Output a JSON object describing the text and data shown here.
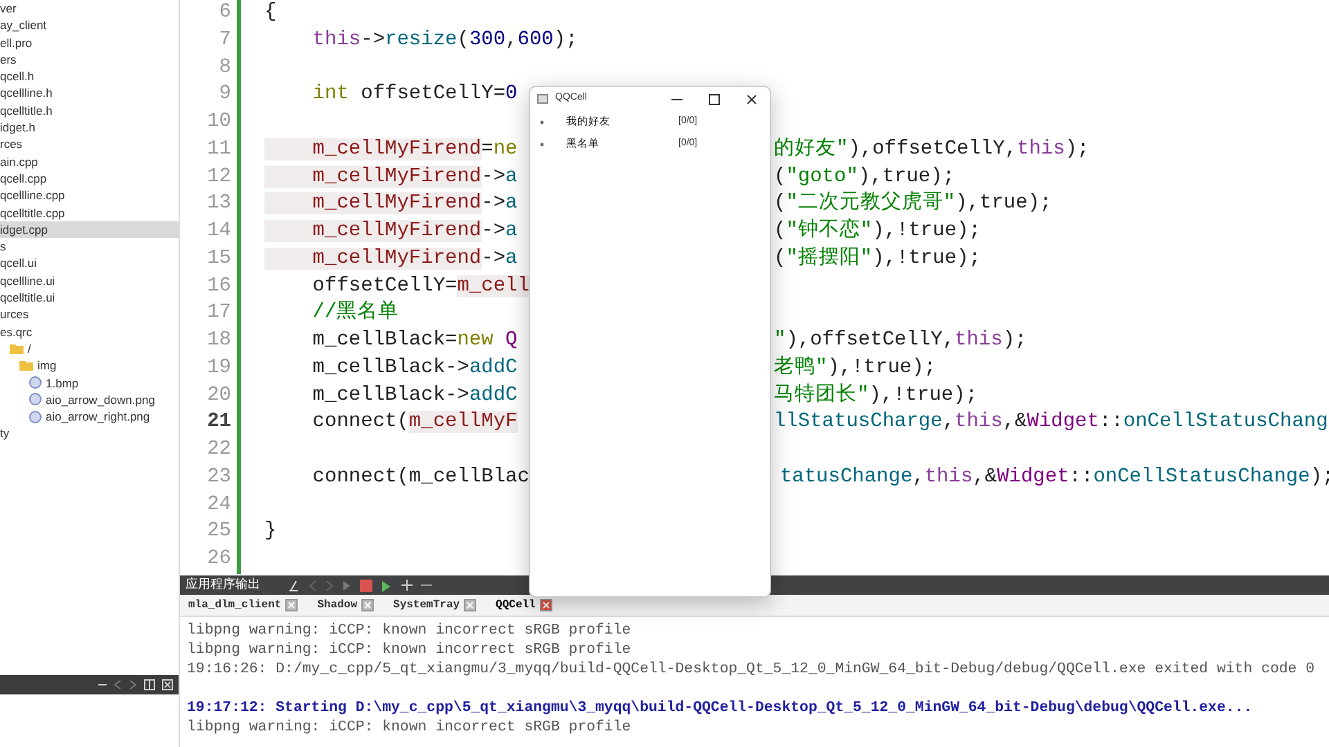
{
  "project_tree": {
    "items": [
      {
        "text": "ver",
        "selected": false
      },
      {
        "text": "ay_client",
        "selected": false
      },
      {
        "text": "ell.pro",
        "selected": false
      },
      {
        "text": "ers",
        "selected": false
      },
      {
        "text": "qcell.h",
        "selected": false
      },
      {
        "text": "qcellline.h",
        "selected": false
      },
      {
        "text": "qcelltitle.h",
        "selected": false
      },
      {
        "text": "idget.h",
        "selected": false
      },
      {
        "text": "rces",
        "selected": false
      },
      {
        "text": "ain.cpp",
        "selected": false
      },
      {
        "text": "qcell.cpp",
        "selected": false
      },
      {
        "text": "qcellline.cpp",
        "selected": false
      },
      {
        "text": "qcelltitle.cpp",
        "selected": false
      },
      {
        "text": "idget.cpp",
        "selected": true
      },
      {
        "text": "s",
        "selected": false
      },
      {
        "text": "qcell.ui",
        "selected": false
      },
      {
        "text": "qcellline.ui",
        "selected": false
      },
      {
        "text": "qcelltitle.ui",
        "selected": false
      },
      {
        "text": "urces",
        "selected": false
      },
      {
        "text": "es.qrc",
        "selected": false,
        "children": [
          {
            "text": "/",
            "selected": false,
            "kind": "folder",
            "children": [
              {
                "text": "img",
                "selected": false,
                "kind": "folder",
                "children": [
                  {
                    "text": "1.bmp",
                    "selected": false,
                    "kind": "image"
                  },
                  {
                    "text": "aio_arrow_down.png",
                    "selected": false,
                    "kind": "image"
                  },
                  {
                    "text": "aio_arrow_right.png",
                    "selected": false,
                    "kind": "image"
                  }
                ]
              }
            ]
          }
        ]
      },
      {
        "text": "ty",
        "selected": false
      }
    ]
  },
  "editor": {
    "lines": [
      {
        "number": "6",
        "current": false,
        "left": [
          {
            "text": "{",
            "kind": "plain"
          }
        ]
      },
      {
        "number": "7",
        "current": false,
        "left": [
          {
            "text": "    this",
            "kind": "self"
          },
          {
            "text": "->",
            "kind": "plain"
          },
          {
            "text": "resize",
            "kind": "method"
          },
          {
            "text": "(",
            "kind": "plain"
          },
          {
            "text": "300",
            "kind": "number"
          },
          {
            "text": ",",
            "kind": "plain"
          },
          {
            "text": "600",
            "kind": "number"
          },
          {
            "text": ");",
            "kind": "plain"
          }
        ]
      },
      {
        "number": "8",
        "current": false
      },
      {
        "number": "9",
        "current": false,
        "left": [
          {
            "text": "    int",
            "kind": "keyword"
          },
          {
            "text": " offsetCellY=",
            "kind": "plain"
          },
          {
            "text": "0",
            "kind": "number"
          }
        ]
      },
      {
        "number": "10",
        "current": false
      },
      {
        "number": "11",
        "current": false,
        "left": [
          {
            "text": "    m_cellMyFirend",
            "kind": "field"
          },
          {
            "text": "=",
            "kind": "plain"
          },
          {
            "text": "ne",
            "kind": "keyword"
          }
        ],
        "right": [
          {
            "text": "的好友\"",
            "kind": "string"
          },
          {
            "text": "),offsetCellY,",
            "kind": "plain"
          },
          {
            "text": "this",
            "kind": "self"
          },
          {
            "text": ");",
            "kind": "plain"
          }
        ]
      },
      {
        "number": "12",
        "current": false,
        "left": [
          {
            "text": "    m_cellMyFirend",
            "kind": "field"
          },
          {
            "text": "->",
            "kind": "plain"
          },
          {
            "text": "a",
            "kind": "method"
          }
        ],
        "right": [
          {
            "text": "(",
            "kind": "plain"
          },
          {
            "text": "\"goto\"",
            "kind": "string"
          },
          {
            "text": "),true);",
            "kind": "plain"
          }
        ]
      },
      {
        "number": "13",
        "current": false,
        "left": [
          {
            "text": "    m_cellMyFirend",
            "kind": "field"
          },
          {
            "text": "->",
            "kind": "plain"
          },
          {
            "text": "a",
            "kind": "method"
          }
        ],
        "right": [
          {
            "text": "(",
            "kind": "plain"
          },
          {
            "text": "\"二次元教父虎哥\"",
            "kind": "string"
          },
          {
            "text": "),true);",
            "kind": "plain"
          }
        ]
      },
      {
        "number": "14",
        "current": false,
        "left": [
          {
            "text": "    m_cellMyFirend",
            "kind": "field"
          },
          {
            "text": "->",
            "kind": "plain"
          },
          {
            "text": "a",
            "kind": "method"
          }
        ],
        "right": [
          {
            "text": "(",
            "kind": "plain"
          },
          {
            "text": "\"钟不恋\"",
            "kind": "string"
          },
          {
            "text": "),!true);",
            "kind": "plain"
          }
        ]
      },
      {
        "number": "15",
        "current": false,
        "left": [
          {
            "text": "    m_cellMyFirend",
            "kind": "field"
          },
          {
            "text": "->",
            "kind": "plain"
          },
          {
            "text": "a",
            "kind": "method"
          }
        ],
        "right": [
          {
            "text": "(",
            "kind": "plain"
          },
          {
            "text": "\"摇摆阳\"",
            "kind": "string"
          },
          {
            "text": "),!true);",
            "kind": "plain"
          }
        ]
      },
      {
        "number": "16",
        "current": false,
        "left": [
          {
            "text": "    offsetCellY=",
            "kind": "plain"
          },
          {
            "text": "m_cell",
            "kind": "field"
          }
        ]
      },
      {
        "number": "17",
        "current": false,
        "left": [
          {
            "text": "    //黑名单",
            "kind": "comment"
          }
        ]
      },
      {
        "number": "18",
        "current": false,
        "left": [
          {
            "text": "    m_cellBlack=",
            "kind": "plain"
          },
          {
            "text": "new",
            "kind": "keyword"
          },
          {
            "text": " Q",
            "kind": "type"
          }
        ],
        "right": [
          {
            "text": "\"",
            "kind": "string"
          },
          {
            "text": "),offsetCellY,",
            "kind": "plain"
          },
          {
            "text": "this",
            "kind": "self"
          },
          {
            "text": ");",
            "kind": "plain"
          }
        ]
      },
      {
        "number": "19",
        "current": false,
        "left": [
          {
            "text": "    m_cellBlack->",
            "kind": "plain"
          },
          {
            "text": "addC",
            "kind": "method"
          }
        ],
        "right": [
          {
            "text": "老鸭\"",
            "kind": "string"
          },
          {
            "text": "),!true);",
            "kind": "plain"
          }
        ]
      },
      {
        "number": "20",
        "current": false,
        "left": [
          {
            "text": "    m_cellBlack->",
            "kind": "plain"
          },
          {
            "text": "addC",
            "kind": "method"
          }
        ],
        "right": [
          {
            "text": "马特团长\"",
            "kind": "string"
          },
          {
            "text": "),!true);",
            "kind": "plain"
          }
        ]
      },
      {
        "number": "21",
        "current": true,
        "left": [
          {
            "text": "    connect(",
            "kind": "plain"
          },
          {
            "text": "m_cellMyF",
            "kind": "field"
          }
        ],
        "right": [
          {
            "text": "llStatusCharge",
            "kind": "method"
          },
          {
            "text": ",",
            "kind": "plain"
          },
          {
            "text": "this",
            "kind": "self"
          },
          {
            "text": ",&",
            "kind": "plain"
          },
          {
            "text": "Widget",
            "kind": "type"
          },
          {
            "text": "::",
            "kind": "plain"
          },
          {
            "text": "onCellStatusChang",
            "kind": "method"
          }
        ]
      },
      {
        "number": "22",
        "current": false
      },
      {
        "number": "23",
        "current": false,
        "left": [
          {
            "text": "    connect(m_cellBlac",
            "kind": "plain"
          }
        ],
        "right": [
          {
            "text": "tatusChange",
            "kind": "method"
          },
          {
            "text": ",",
            "kind": "plain"
          },
          {
            "text": "this",
            "kind": "self"
          },
          {
            "text": ",&",
            "kind": "plain"
          },
          {
            "text": "Widget",
            "kind": "type"
          },
          {
            "text": "::",
            "kind": "plain"
          },
          {
            "text": "onCellStatusChange",
            "kind": "method"
          },
          {
            "text": ");",
            "kind": "plain"
          }
        ]
      },
      {
        "number": "24",
        "current": false
      },
      {
        "number": "25",
        "current": false,
        "left": [
          {
            "text": "}",
            "kind": "plain"
          }
        ]
      },
      {
        "number": "26",
        "current": false
      }
    ]
  },
  "app_window": {
    "title": "QQCell",
    "groups": [
      {
        "name": "我的好友",
        "count": "[0/0]"
      },
      {
        "name": "黑名单",
        "count": "[0/0]"
      }
    ]
  },
  "output_pane": {
    "title": "应用程序输出",
    "tabs": [
      {
        "label": "mla_dlm_client",
        "selected": false
      },
      {
        "label": "Shadow",
        "selected": false
      },
      {
        "label": "SystemTray",
        "selected": false
      },
      {
        "label": "QQCell",
        "selected": true
      }
    ],
    "lines": [
      {
        "text": "libpng warning: iCCP: known incorrect sRGB profile",
        "kind": "warning"
      },
      {
        "text": "libpng warning: iCCP: known incorrect sRGB profile",
        "kind": "warning"
      },
      {
        "text": "19:16:26: D:/my_c_cpp/5_qt_xiangmu/3_myqq/build-QQCell-Desktop_Qt_5_12_0_MinGW_64_bit-Debug/debug/QQCell.exe exited with code 0",
        "kind": "exit"
      },
      {
        "text": "19:17:12: Starting D:\\my_c_cpp\\5_qt_xiangmu\\3_myqq\\build-QQCell-Desktop_Qt_5_12_0_MinGW_64_bit-Debug\\debug\\QQCell.exe...",
        "kind": "start"
      },
      {
        "text": "libpng warning: iCCP: known incorrect sRGB profile",
        "kind": "warning"
      }
    ]
  }
}
